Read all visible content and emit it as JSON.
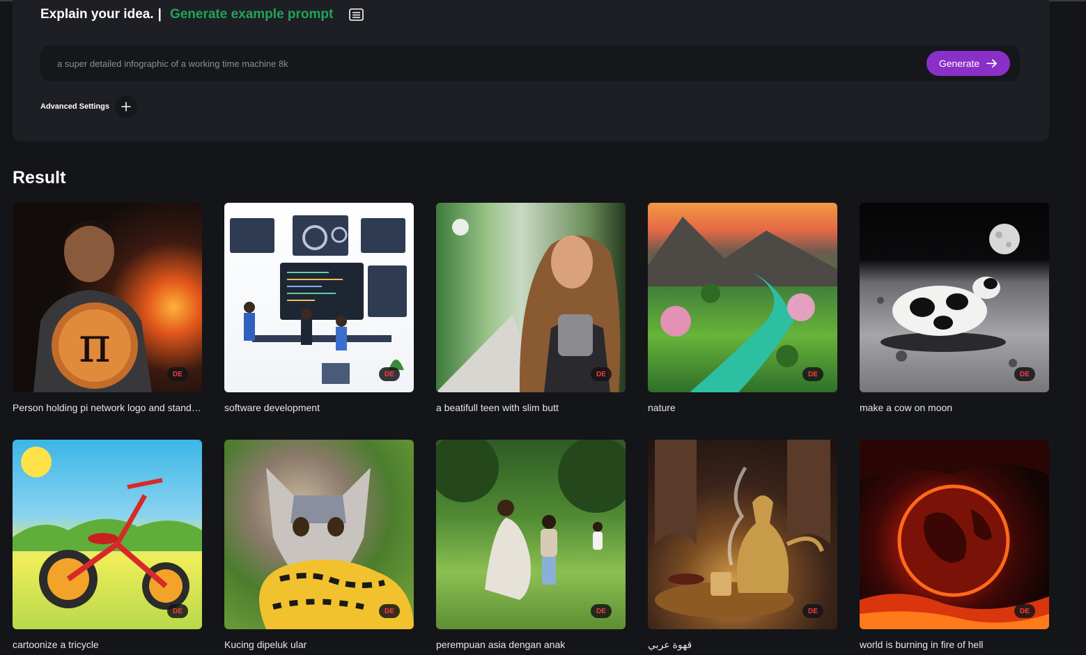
{
  "prompt_panel": {
    "heading": "Explain your idea.",
    "separator": "|",
    "example_link": "Generate example prompt",
    "prompt_placeholder": "a super detailed infographic of a working time machine 8k",
    "generate_label": "Generate",
    "advanced_label": "Advanced Settings"
  },
  "result": {
    "title": "Result",
    "items": [
      {
        "caption": "Person holding pi network logo and standing near fire",
        "badge": "DE"
      },
      {
        "caption": "software development",
        "badge": "DE"
      },
      {
        "caption": "a beatifull teen with slim butt",
        "badge": "DE"
      },
      {
        "caption": "nature",
        "badge": "DE"
      },
      {
        "caption": "make a cow on moon",
        "badge": "DE"
      },
      {
        "caption": "cartoonize a tricycle",
        "badge": "DE"
      },
      {
        "caption": "Kucing dipeluk ular",
        "badge": "DE"
      },
      {
        "caption": "perempuan asia dengan anak",
        "badge": "DE"
      },
      {
        "caption": "قهوة عربي",
        "badge": "DE"
      },
      {
        "caption": "world is burning in fire of hell",
        "badge": "DE"
      }
    ]
  },
  "colors": {
    "background": "#141519",
    "panel": "#1e1f24",
    "accent_green": "#1fa45a",
    "generate_button": "#8b2fc9",
    "badge_text": "#ff3b3b"
  },
  "icons": [
    "document-lines-icon",
    "arrow-right-icon",
    "plus-icon"
  ]
}
